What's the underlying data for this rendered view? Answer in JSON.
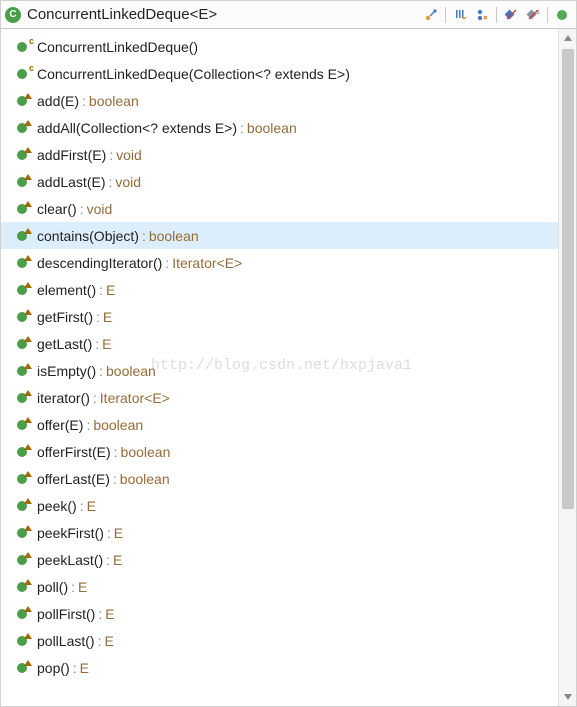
{
  "header": {
    "class_name": "ConcurrentLinkedDeque<E>"
  },
  "watermark": "http://blog.csdn.net/hxpjava1",
  "members": [
    {
      "kind": "constructor",
      "sig": "ConcurrentLinkedDeque()",
      "ret": null,
      "selected": false
    },
    {
      "kind": "constructor",
      "sig": "ConcurrentLinkedDeque(Collection<? extends E>)",
      "ret": null,
      "selected": false
    },
    {
      "kind": "method",
      "sig": "add(E)",
      "ret": "boolean",
      "selected": false
    },
    {
      "kind": "method",
      "sig": "addAll(Collection<? extends E>)",
      "ret": "boolean",
      "selected": false
    },
    {
      "kind": "method",
      "sig": "addFirst(E)",
      "ret": "void",
      "selected": false
    },
    {
      "kind": "method",
      "sig": "addLast(E)",
      "ret": "void",
      "selected": false
    },
    {
      "kind": "method",
      "sig": "clear()",
      "ret": "void",
      "selected": false
    },
    {
      "kind": "method",
      "sig": "contains(Object)",
      "ret": "boolean",
      "selected": true
    },
    {
      "kind": "method",
      "sig": "descendingIterator()",
      "ret": "Iterator<E>",
      "selected": false
    },
    {
      "kind": "method",
      "sig": "element()",
      "ret": "E",
      "selected": false
    },
    {
      "kind": "method",
      "sig": "getFirst()",
      "ret": "E",
      "selected": false
    },
    {
      "kind": "method",
      "sig": "getLast()",
      "ret": "E",
      "selected": false
    },
    {
      "kind": "method",
      "sig": "isEmpty()",
      "ret": "boolean",
      "selected": false
    },
    {
      "kind": "method",
      "sig": "iterator()",
      "ret": "Iterator<E>",
      "selected": false
    },
    {
      "kind": "method",
      "sig": "offer(E)",
      "ret": "boolean",
      "selected": false
    },
    {
      "kind": "method",
      "sig": "offerFirst(E)",
      "ret": "boolean",
      "selected": false
    },
    {
      "kind": "method",
      "sig": "offerLast(E)",
      "ret": "boolean",
      "selected": false
    },
    {
      "kind": "method",
      "sig": "peek()",
      "ret": "E",
      "selected": false
    },
    {
      "kind": "method",
      "sig": "peekFirst()",
      "ret": "E",
      "selected": false
    },
    {
      "kind": "method",
      "sig": "peekLast()",
      "ret": "E",
      "selected": false
    },
    {
      "kind": "method",
      "sig": "poll()",
      "ret": "E",
      "selected": false
    },
    {
      "kind": "method",
      "sig": "pollFirst()",
      "ret": "E",
      "selected": false
    },
    {
      "kind": "method",
      "sig": "pollLast()",
      "ret": "E",
      "selected": false
    },
    {
      "kind": "method",
      "sig": "pop()",
      "ret": "E",
      "selected": false
    }
  ]
}
